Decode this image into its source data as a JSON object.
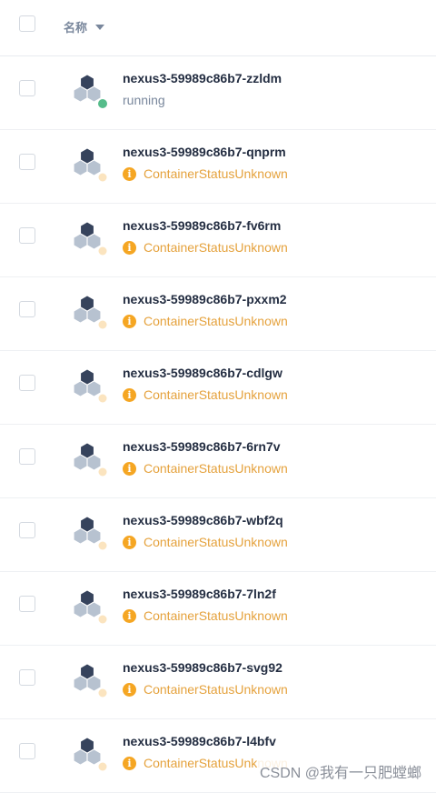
{
  "header": {
    "name_label": "名称"
  },
  "pods": [
    {
      "name": "nexus3-59989c86b7-zzldm",
      "status": "running",
      "state": "running",
      "dot_color": "#55bc8a"
    },
    {
      "name": "nexus3-59989c86b7-qnprm",
      "status": "ContainerStatusUnknown",
      "state": "warn",
      "dot_color": "#fbe4bf"
    },
    {
      "name": "nexus3-59989c86b7-fv6rm",
      "status": "ContainerStatusUnknown",
      "state": "warn",
      "dot_color": "#fbe4bf"
    },
    {
      "name": "nexus3-59989c86b7-pxxm2",
      "status": "ContainerStatusUnknown",
      "state": "warn",
      "dot_color": "#fbe4bf"
    },
    {
      "name": "nexus3-59989c86b7-cdlgw",
      "status": "ContainerStatusUnknown",
      "state": "warn",
      "dot_color": "#fbe4bf"
    },
    {
      "name": "nexus3-59989c86b7-6rn7v",
      "status": "ContainerStatusUnknown",
      "state": "warn",
      "dot_color": "#fbe4bf"
    },
    {
      "name": "nexus3-59989c86b7-wbf2q",
      "status": "ContainerStatusUnknown",
      "state": "warn",
      "dot_color": "#fbe4bf"
    },
    {
      "name": "nexus3-59989c86b7-7ln2f",
      "status": "ContainerStatusUnknown",
      "state": "warn",
      "dot_color": "#fbe4bf"
    },
    {
      "name": "nexus3-59989c86b7-svg92",
      "status": "ContainerStatusUnknown",
      "state": "warn",
      "dot_color": "#fbe4bf"
    },
    {
      "name": "nexus3-59989c86b7-l4bfv",
      "status": "ContainerStatusUnknown",
      "state": "warn",
      "dot_color": "#fbe4bf"
    }
  ],
  "icons": {
    "pod": "pod-icon",
    "status_info": "info-icon",
    "sort": "caret-down-icon"
  },
  "colors": {
    "hex_top": "#36435c",
    "hex_bottom": "#b7c2d0",
    "running": "#55bc8a",
    "warning": "#f5a623"
  },
  "watermark": "CSDN @我有一只肥螳螂"
}
